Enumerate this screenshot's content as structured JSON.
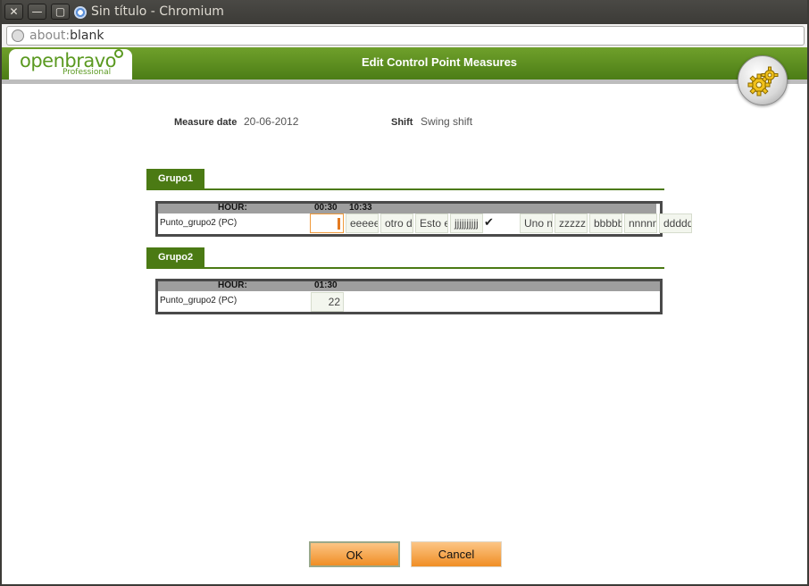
{
  "window": {
    "title": "Sin título - Chromium",
    "close_glyph": "✕",
    "min_glyph": "—",
    "max_glyph": "▢"
  },
  "address": {
    "protocol": "about:",
    "path": "blank"
  },
  "app": {
    "logo_text": "openbravo",
    "logo_sub": "Professional",
    "title": "Edit Control Point Measures",
    "gear_icon": "gears-icon"
  },
  "form": {
    "measure_date_label": "Measure date",
    "measure_date_value": "20-06-2012",
    "shift_label": "Shift",
    "shift_value": "Swing shift"
  },
  "groups": [
    {
      "name": "Grupo1",
      "hour_label": "HOUR:",
      "hours": [
        "00:30",
        "10:33"
      ],
      "row_label": "Punto_grupo2 (PC)",
      "cells": [
        "",
        "eeeee",
        "otro d",
        "Esto e",
        "jjjjjjjjjj",
        "✔",
        "Uno n",
        "zzzzz",
        "bbbbb",
        "nnnnn",
        "ddddd"
      ]
    },
    {
      "name": "Grupo2",
      "hour_label": "HOUR:",
      "hours": [
        "01:30"
      ],
      "row_label": "Punto_grupo2 (PC)",
      "cells": [
        "22"
      ]
    }
  ],
  "buttons": {
    "ok": "OK",
    "cancel": "Cancel"
  },
  "colors": {
    "header_green": "#4c7d16",
    "section_green": "#4b7a14",
    "button_orange": "#f08e25"
  }
}
